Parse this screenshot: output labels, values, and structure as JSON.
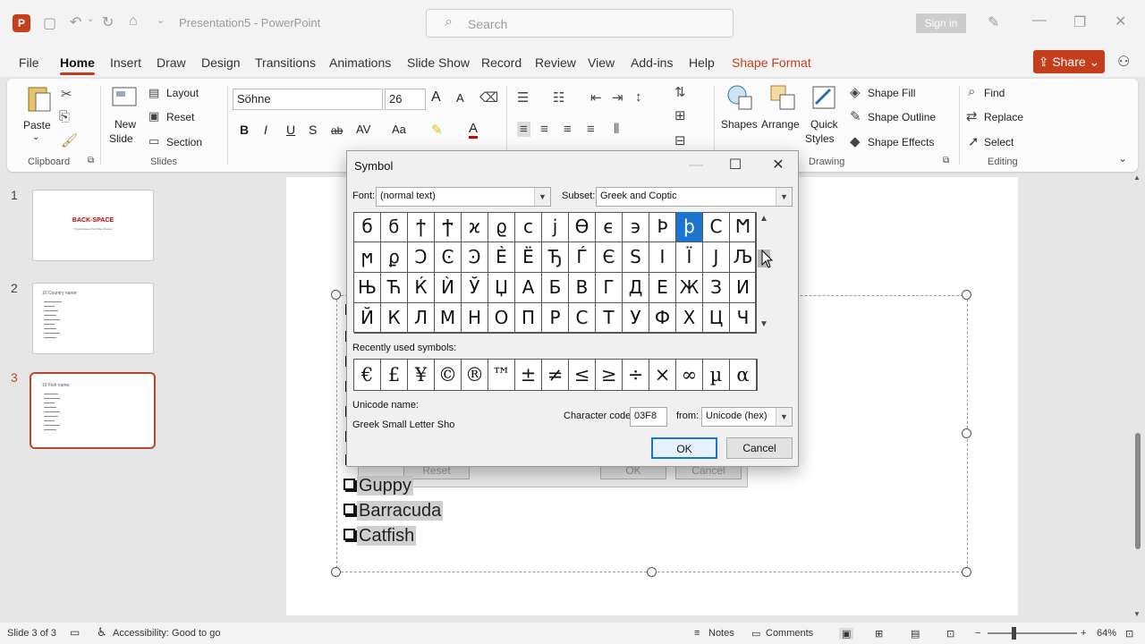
{
  "app": {
    "document_title": "Presentation5",
    "separator": " - ",
    "app_name": "PowerPoint",
    "search_placeholder": "Search",
    "sign_in": "Sign in",
    "share": "Share"
  },
  "tabs": [
    "File",
    "Home",
    "Insert",
    "Draw",
    "Design",
    "Transitions",
    "Animations",
    "Slide Show",
    "Record",
    "Review",
    "View",
    "Add-ins",
    "Help",
    "Shape Format"
  ],
  "active_tab": "Home",
  "ribbon": {
    "clipboard": {
      "paste": "Paste",
      "group": "Clipboard"
    },
    "slides": {
      "new_slide_1": "New",
      "new_slide_2": "Slide",
      "layout": "Layout",
      "reset": "Reset",
      "section": "Section",
      "group": "Slides"
    },
    "font": {
      "name": "Söhne",
      "size": "26",
      "bold": "B",
      "italic": "I",
      "underline": "U",
      "shadow": "S",
      "strike": "ab",
      "spacing": "AV",
      "case": "Aa",
      "grow": "A",
      "shrink": "A"
    },
    "drawing": {
      "shapes": "Shapes",
      "arrange": "Arrange",
      "quick_1": "Quick",
      "quick_2": "Styles",
      "fill": "Shape Fill",
      "outline": "Shape Outline",
      "effects": "Shape Effects",
      "group": "Drawing"
    },
    "editing": {
      "find": "Find",
      "replace": "Replace",
      "select": "Select",
      "group": "Editing"
    }
  },
  "slides": [
    {
      "num": "1",
      "title": "BACK-SPACE",
      "subtitle": "Tutorial based YouTube channel"
    },
    {
      "num": "2",
      "title": "10 Country name:"
    },
    {
      "num": "3",
      "title": "10 Fish name:"
    }
  ],
  "slide_content": [
    "Guppy",
    "Barracuda",
    "Catfish"
  ],
  "ghost_dialog": {
    "reset": "Reset",
    "ok": "OK",
    "cancel": "Cancel"
  },
  "symbol_dialog": {
    "title": "Symbol",
    "font_label": "Font:",
    "font_value": "(normal text)",
    "subset_label": "Subset:",
    "subset_value": "Greek and Coptic",
    "symbols": [
      [
        "б",
        "ϭ",
        "ϯ",
        "Ϯ",
        "ϰ",
        "ϱ",
        "ϲ",
        "ϳ",
        "ϴ",
        "ϵ",
        "϶",
        "Ϸ",
        "ϸ",
        "Ϲ",
        "Ϻ"
      ],
      [
        "ϻ",
        "ϼ",
        "Ͻ",
        "Ͼ",
        "Ͽ",
        "Ѐ",
        "Ё",
        "Ђ",
        "Ѓ",
        "Є",
        "Ѕ",
        "І",
        "Ї",
        "Ј",
        "Љ"
      ],
      [
        "Њ",
        "Ћ",
        "Ќ",
        "Ѝ",
        "Ў",
        "Џ",
        "А",
        "Б",
        "В",
        "Г",
        "Д",
        "Е",
        "Ж",
        "З",
        "И"
      ],
      [
        "Й",
        "К",
        "Л",
        "М",
        "Н",
        "О",
        "П",
        "Р",
        "С",
        "Т",
        "У",
        "Ф",
        "Х",
        "Ц",
        "Ч"
      ]
    ],
    "selected_symbol": "ϸ",
    "recent_label": "Recently used symbols:",
    "recent": [
      "€",
      "£",
      "¥",
      "©",
      "®",
      "™",
      "±",
      "≠",
      "≤",
      "≥",
      "÷",
      "×",
      "∞",
      "µ",
      "α"
    ],
    "unicode_name_label": "Unicode name:",
    "unicode_name": "Greek Small Letter Sho",
    "char_code_label": "Character code:",
    "char_code": "03F8",
    "from_label": "from:",
    "from_value": "Unicode (hex)",
    "ok": "OK",
    "cancel": "Cancel"
  },
  "status": {
    "slide_info": "Slide 3 of 3",
    "accessibility": "Accessibility: Good to go",
    "notes": "Notes",
    "comments": "Comments",
    "zoom": "64%"
  },
  "colors": {
    "accent": "#c43e1c",
    "selection": "#1a74d0"
  }
}
